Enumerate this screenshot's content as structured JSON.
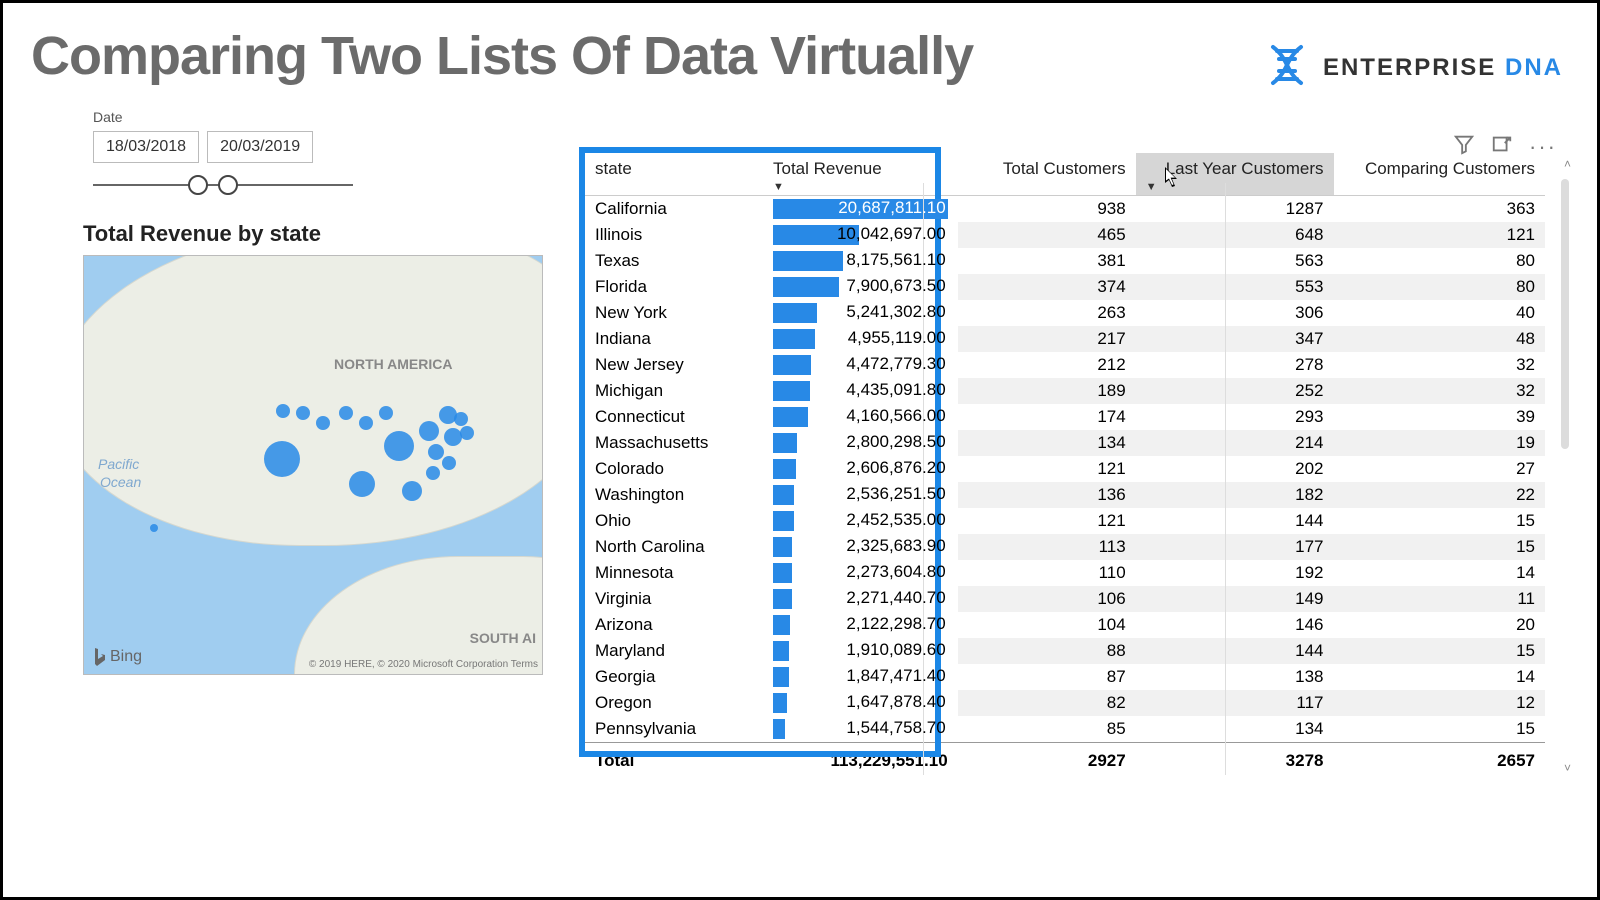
{
  "page_title": "Comparing Two Lists Of Data Virtually",
  "brand": {
    "name": "ENTERPRISE",
    "accent": "DNA"
  },
  "date_slicer": {
    "label": "Date",
    "from": "18/03/2018",
    "to": "20/03/2019"
  },
  "map": {
    "title": "Total Revenue by state",
    "label_na": "NORTH AMERICA",
    "label_sa": "SOUTH AI",
    "label_ocean1": "Pacific",
    "label_ocean2": "Ocean",
    "bing": "Bing",
    "attribution": "© 2019 HERE, © 2020 Microsoft Corporation  Terms"
  },
  "table": {
    "headers": {
      "state": "state",
      "revenue": "Total Revenue",
      "total_customers": "Total Customers",
      "last_year": "Last Year Customers",
      "comparing": "Comparing Customers"
    },
    "sort_column": "revenue",
    "hover_column": "last_year",
    "rows": [
      {
        "state": "California",
        "revenue": "20,687,811.10",
        "rev_pct": 100,
        "tc": "938",
        "ly": "1287",
        "cc": "363"
      },
      {
        "state": "Illinois",
        "revenue": "10,042,697.00",
        "rev_pct": 49,
        "tc": "465",
        "ly": "648",
        "cc": "121"
      },
      {
        "state": "Texas",
        "revenue": "8,175,561.10",
        "rev_pct": 40,
        "tc": "381",
        "ly": "563",
        "cc": "80"
      },
      {
        "state": "Florida",
        "revenue": "7,900,673.50",
        "rev_pct": 38,
        "tc": "374",
        "ly": "553",
        "cc": "80"
      },
      {
        "state": "New York",
        "revenue": "5,241,302.80",
        "rev_pct": 25,
        "tc": "263",
        "ly": "306",
        "cc": "40"
      },
      {
        "state": "Indiana",
        "revenue": "4,955,119.00",
        "rev_pct": 24,
        "tc": "217",
        "ly": "347",
        "cc": "48"
      },
      {
        "state": "New Jersey",
        "revenue": "4,472,779.30",
        "rev_pct": 22,
        "tc": "212",
        "ly": "278",
        "cc": "32"
      },
      {
        "state": "Michigan",
        "revenue": "4,435,091.80",
        "rev_pct": 21,
        "tc": "189",
        "ly": "252",
        "cc": "32"
      },
      {
        "state": "Connecticut",
        "revenue": "4,160,566.00",
        "rev_pct": 20,
        "tc": "174",
        "ly": "293",
        "cc": "39"
      },
      {
        "state": "Massachusetts",
        "revenue": "2,800,298.50",
        "rev_pct": 14,
        "tc": "134",
        "ly": "214",
        "cc": "19"
      },
      {
        "state": "Colorado",
        "revenue": "2,606,876.20",
        "rev_pct": 13,
        "tc": "121",
        "ly": "202",
        "cc": "27"
      },
      {
        "state": "Washington",
        "revenue": "2,536,251.50",
        "rev_pct": 12,
        "tc": "136",
        "ly": "182",
        "cc": "22"
      },
      {
        "state": "Ohio",
        "revenue": "2,452,535.00",
        "rev_pct": 12,
        "tc": "121",
        "ly": "144",
        "cc": "15"
      },
      {
        "state": "North Carolina",
        "revenue": "2,325,683.90",
        "rev_pct": 11,
        "tc": "113",
        "ly": "177",
        "cc": "15"
      },
      {
        "state": "Minnesota",
        "revenue": "2,273,604.80",
        "rev_pct": 11,
        "tc": "110",
        "ly": "192",
        "cc": "14"
      },
      {
        "state": "Virginia",
        "revenue": "2,271,440.70",
        "rev_pct": 11,
        "tc": "106",
        "ly": "149",
        "cc": "11"
      },
      {
        "state": "Arizona",
        "revenue": "2,122,298.70",
        "rev_pct": 10,
        "tc": "104",
        "ly": "146",
        "cc": "20"
      },
      {
        "state": "Maryland",
        "revenue": "1,910,089.60",
        "rev_pct": 9,
        "tc": "88",
        "ly": "144",
        "cc": "15"
      },
      {
        "state": "Georgia",
        "revenue": "1,847,471.40",
        "rev_pct": 9,
        "tc": "87",
        "ly": "138",
        "cc": "14"
      },
      {
        "state": "Oregon",
        "revenue": "1,647,878.40",
        "rev_pct": 8,
        "tc": "82",
        "ly": "117",
        "cc": "12"
      },
      {
        "state": "Pennsylvania",
        "revenue": "1,544,758.70",
        "rev_pct": 7,
        "tc": "85",
        "ly": "134",
        "cc": "15"
      }
    ],
    "total": {
      "label": "Total",
      "revenue": "113,229,551.10",
      "tc": "2927",
      "ly": "3278",
      "cc": "2657"
    }
  },
  "chart_data": {
    "type": "bar",
    "title": "Total Revenue by state (horizontal bar)",
    "xlabel": "Total Revenue",
    "ylabel": "state",
    "categories": [
      "California",
      "Illinois",
      "Texas",
      "Florida",
      "New York",
      "Indiana",
      "New Jersey",
      "Michigan",
      "Connecticut",
      "Massachusetts",
      "Colorado",
      "Washington",
      "Ohio",
      "North Carolina",
      "Minnesota",
      "Virginia",
      "Arizona",
      "Maryland",
      "Georgia",
      "Oregon",
      "Pennsylvania"
    ],
    "values": [
      20687811.1,
      10042697.0,
      8175561.1,
      7900673.5,
      5241302.8,
      4955119.0,
      4472779.3,
      4435091.8,
      4160566.0,
      2800298.5,
      2606876.2,
      2536251.5,
      2452535.0,
      2325683.9,
      2273604.8,
      2271440.7,
      2122298.7,
      1910089.6,
      1847471.4,
      1647878.4,
      1544758.7
    ],
    "xlim": [
      0,
      20687811.1
    ]
  }
}
